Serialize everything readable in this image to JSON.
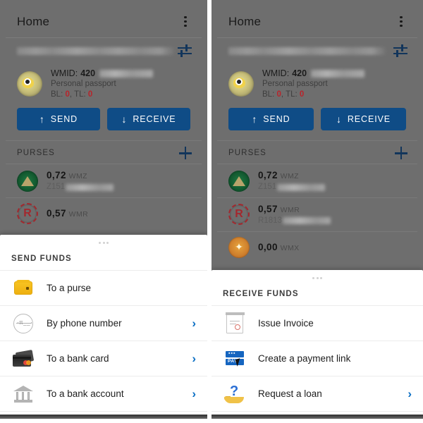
{
  "screens": [
    {
      "id": "send-funds-screen",
      "appbar": {
        "title": "Home",
        "menu_icon": "kebab-menu-icon"
      },
      "account": {
        "email_masked": "",
        "tune_icon": "tune-sliders-icon",
        "wmid_label": "WMID:",
        "wmid_value": "420",
        "passport": "Personal passport",
        "bl_label": "BL:",
        "bl_value": "0",
        "tl_label": "TL:",
        "tl_value": "0"
      },
      "actions": {
        "send": "SEND",
        "send_arrow": "↑",
        "receive": "RECEIVE",
        "receive_arrow": "↓"
      },
      "purses": {
        "title": "PURSES",
        "add_icon": "plus-icon",
        "items": [
          {
            "icon": "wmz-purse-icon",
            "amount": "0,72",
            "currency": "WMZ",
            "number_prefix": "Z151"
          },
          {
            "icon": "wmr-purse-icon",
            "amount": "0,57",
            "currency": "WMR",
            "number_prefix": ""
          }
        ]
      },
      "sheet": {
        "title": "SEND FUNDS",
        "rows": [
          {
            "icon": "purse-icon",
            "label": "To a purse",
            "chevron": ""
          },
          {
            "icon": "phone-number-icon",
            "label": "By phone number",
            "chevron": "›"
          },
          {
            "icon": "bank-card-icon",
            "label": "To a bank card",
            "chevron": "›"
          },
          {
            "icon": "bank-account-icon",
            "label": "To a bank account",
            "chevron": "›"
          }
        ]
      }
    },
    {
      "id": "receive-funds-screen",
      "appbar": {
        "title": "Home",
        "menu_icon": "kebab-menu-icon"
      },
      "account": {
        "email_masked": "",
        "tune_icon": "tune-sliders-icon",
        "wmid_label": "WMID:",
        "wmid_value": "420",
        "passport": "Personal passport",
        "bl_label": "BL:",
        "bl_value": "0",
        "tl_label": "TL:",
        "tl_value": "0"
      },
      "actions": {
        "send": "SEND",
        "send_arrow": "↑",
        "receive": "RECEIVE",
        "receive_arrow": "↓"
      },
      "purses": {
        "title": "PURSES",
        "add_icon": "plus-icon",
        "items": [
          {
            "icon": "wmz-purse-icon",
            "amount": "0,72",
            "currency": "WMZ",
            "number_prefix": "Z151"
          },
          {
            "icon": "wmr-purse-icon",
            "amount": "0,57",
            "currency": "WMR",
            "number_prefix": "R1813"
          },
          {
            "icon": "wmx-purse-icon",
            "amount": "0,00",
            "currency": "WMX",
            "number_prefix": ""
          }
        ]
      },
      "sheet": {
        "title": "RECEIVE FUNDS",
        "rows": [
          {
            "icon": "invoice-icon",
            "label": "Issue Invoice",
            "chevron": ""
          },
          {
            "icon": "payment-link-icon",
            "label": "Create a payment link",
            "chevron": ""
          },
          {
            "icon": "loan-request-icon",
            "label": "Request a loan",
            "chevron": "›"
          }
        ]
      }
    }
  ],
  "colors": {
    "accent_blue": "#0f4c86",
    "chevron_blue": "#0b6fc4",
    "alert_red": "#b8242b",
    "scrim_grey": "#6e6e6e",
    "sheet_white": "#ffffff"
  }
}
